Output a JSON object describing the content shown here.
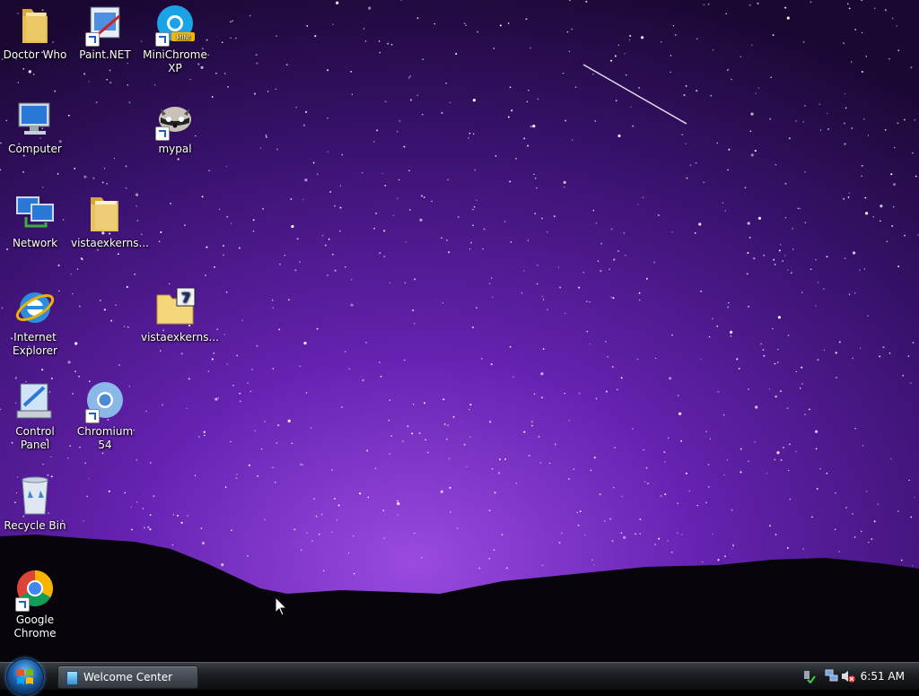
{
  "desktop": {
    "icons": [
      {
        "label": "Doctor Who",
        "icon": "folder-icon"
      },
      {
        "label": "Paint.NET",
        "icon": "paint-net-icon"
      },
      {
        "label": "MiniChrome XP",
        "icon": "minichrome-icon",
        "badge": "MINI"
      },
      {
        "label": "Computer",
        "icon": "computer-icon"
      },
      {
        "label": "mypal",
        "icon": "raccoon-icon"
      },
      {
        "label": "Network",
        "icon": "network-icon"
      },
      {
        "label": "vistaexkerns...",
        "icon": "folder-icon"
      },
      {
        "label": "Internet Explorer",
        "icon": "internet-explorer-icon"
      },
      {
        "label": "vistaexkerns...",
        "icon": "zip-folder-icon",
        "badge": "7"
      },
      {
        "label": "Control Panel",
        "icon": "control-panel-icon"
      },
      {
        "label": "Chromium 54",
        "icon": "chromium-icon"
      },
      {
        "label": "Recycle Bin",
        "icon": "recycle-bin-icon"
      },
      {
        "label": "Google Chrome",
        "icon": "chrome-icon"
      }
    ]
  },
  "taskbar": {
    "start_button": "start-orb-icon",
    "tasks": [
      {
        "label": "Welcome Center",
        "icon": "welcome-center-icon"
      }
    ],
    "tray_icons": [
      "safely-remove-hardware-icon",
      "network-tray-icon",
      "volume-muted-icon"
    ],
    "clock": "6:51 AM"
  },
  "colors": {
    "wallpaper_top": "#1a0833",
    "wallpaper_mid": "#5a1fa0",
    "wallpaper_glow": "#8a3fd0",
    "taskbar": "#1b1e22"
  }
}
